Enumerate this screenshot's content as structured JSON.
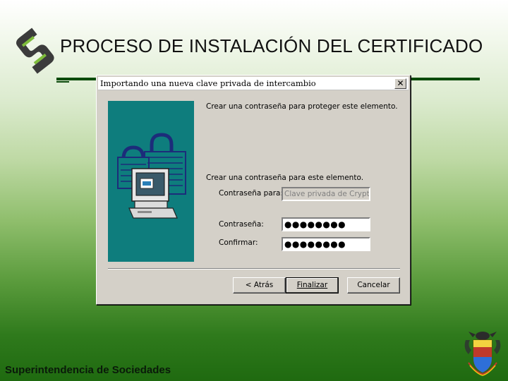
{
  "slide": {
    "title": "PROCESO DE INSTALACIÓN DEL CERTIFICADO",
    "footer": "Superintendencia de Sociedades"
  },
  "dialog": {
    "title": "Importando una nueva clave privada de intercambio",
    "close_label": "✕",
    "heading": "Crear una contraseña para proteger este elemento.",
    "subheading": "Crear una contraseña para este elemento.",
    "for_label": "Contraseña para:",
    "for_value": "Clave privada de Crypto.A",
    "password_label": "Contraseña:",
    "password_value": "●●●●●●●●",
    "confirm_label": "Confirmar:",
    "confirm_value": "●●●●●●●●",
    "buttons": {
      "back": "< Atrás",
      "finish": "Finalizar",
      "cancel": "Cancelar"
    }
  },
  "colors": {
    "side_panel": "#0e7d7d",
    "rule": "#0b4a0b",
    "dialog_bg": "#d4d0c8"
  },
  "icons": [
    "logo-icon",
    "computer-lock-icon",
    "coat-of-arms-icon",
    "close-icon"
  ]
}
